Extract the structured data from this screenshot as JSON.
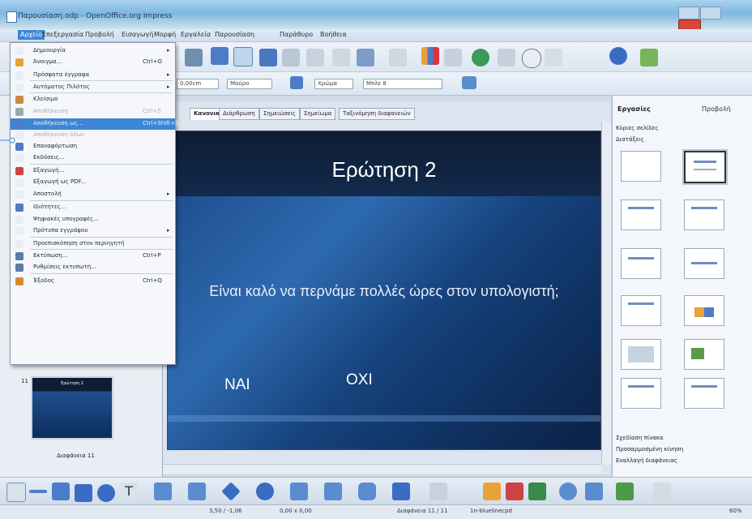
{
  "window": {
    "title": "Παρουσίαση.odp - OpenOffice.org Impress"
  },
  "menubar": [
    "Αρχείο",
    "Επεξεργασία",
    "Προβολή",
    "Εισαγωγή",
    "Μορφή",
    "Εργαλεία",
    "Παρουσίαση",
    "Παράθυρο",
    "Βοήθεια"
  ],
  "toolbar2": {
    "line_width": "0,00cm",
    "color": "Μαύρο",
    "area_style": "Χρώμα",
    "area_color": "Μπλε 8"
  },
  "view_tabs": [
    "Κανονική",
    "Διάρθρωση",
    "Σημειώσεις",
    "Σημείωμα",
    "Ταξινόμηση διαφανειών"
  ],
  "slide": {
    "title": "Ερώτηση 2",
    "question": "Είναι καλό να περνάμε πολλές ώρες στον υπολογιστή;",
    "answer_yes": "ΝΑΙ",
    "answer_no": "ΟΧΙ"
  },
  "slides_panel": {
    "thumb_number": "11",
    "thumb_title": "Ερώτηση 2",
    "caption": "Διαφάνεια 11"
  },
  "tasks": {
    "title": "Εργασίες",
    "view_menu": "Προβολή",
    "sections": {
      "master": "Κύριες σελίδες",
      "layouts": "Διατάξεις",
      "table_design": "Σχεδίαση πίνακα",
      "custom_animation": "Προσαρμοσμένη κίνηση",
      "slide_transition": "Εναλλαγή διαφάνειας"
    }
  },
  "file_menu": [
    {
      "label": "Δημιουργία",
      "shortcut": "",
      "arrow": true,
      "disabled": false,
      "highlight": false
    },
    {
      "label": "Άνοιγμα...",
      "shortcut": "Ctrl+O",
      "arrow": false,
      "disabled": false,
      "highlight": false
    },
    {
      "label": "Πρόσφατα έγγραφα",
      "shortcut": "",
      "arrow": true,
      "disabled": false,
      "highlight": false
    },
    {
      "label": "Αυτόματος Πιλότος",
      "shortcut": "",
      "arrow": true,
      "disabled": false,
      "highlight": false
    },
    {
      "label": "Κλείσιμο",
      "shortcut": "",
      "arrow": false,
      "disabled": false,
      "highlight": false
    },
    {
      "label": "Αποθήκευση",
      "shortcut": "Ctrl+S",
      "arrow": false,
      "disabled": true,
      "highlight": false
    },
    {
      "label": "Αποθήκευση ως...",
      "shortcut": "Ctrl+Shift+S",
      "arrow": false,
      "disabled": false,
      "highlight": true
    },
    {
      "label": "Αποθήκευση όλων",
      "shortcut": "",
      "arrow": false,
      "disabled": true,
      "highlight": false
    },
    {
      "label": "Επαναφόρτωση",
      "shortcut": "",
      "arrow": false,
      "disabled": false,
      "highlight": false
    },
    {
      "label": "Εκδόσεις...",
      "shortcut": "",
      "arrow": false,
      "disabled": false,
      "highlight": false
    },
    {
      "label": "Εξαγωγή...",
      "shortcut": "",
      "arrow": false,
      "disabled": false,
      "highlight": false
    },
    {
      "label": "Εξαγωγή ως PDF...",
      "shortcut": "",
      "arrow": false,
      "disabled": false,
      "highlight": false
    },
    {
      "label": "Αποστολή",
      "shortcut": "",
      "arrow": true,
      "disabled": false,
      "highlight": false
    },
    {
      "label": "Ιδιότητες...",
      "shortcut": "",
      "arrow": false,
      "disabled": false,
      "highlight": false
    },
    {
      "label": "Ψηφιακές υπογραφές...",
      "shortcut": "",
      "arrow": false,
      "disabled": false,
      "highlight": false
    },
    {
      "label": "Πρότυπα εγγράφου",
      "shortcut": "",
      "arrow": true,
      "disabled": false,
      "highlight": false
    },
    {
      "label": "Προεπισκόπηση στον περιηγητή",
      "shortcut": "",
      "arrow": false,
      "disabled": false,
      "highlight": false
    },
    {
      "label": "Εκτύπωση...",
      "shortcut": "Ctrl+P",
      "arrow": false,
      "disabled": false,
      "highlight": false
    },
    {
      "label": "Ρυθμίσεις εκτυπωτή...",
      "shortcut": "",
      "arrow": false,
      "disabled": false,
      "highlight": false
    },
    {
      "label": "Έξοδος",
      "shortcut": "Ctrl+Q",
      "arrow": false,
      "disabled": false,
      "highlight": false
    }
  ],
  "status": {
    "position": "3,50 / -1,06",
    "size": "0,00 x 0,00",
    "slide": "Διαφάνεια 11 / 11",
    "master": "1n-bluelinecpd",
    "zoom": "60%"
  },
  "colors": {
    "menu_highlight": "#3d86d6",
    "slide_dark": "#0c2244",
    "slide_blue": "#1e4f8e"
  }
}
